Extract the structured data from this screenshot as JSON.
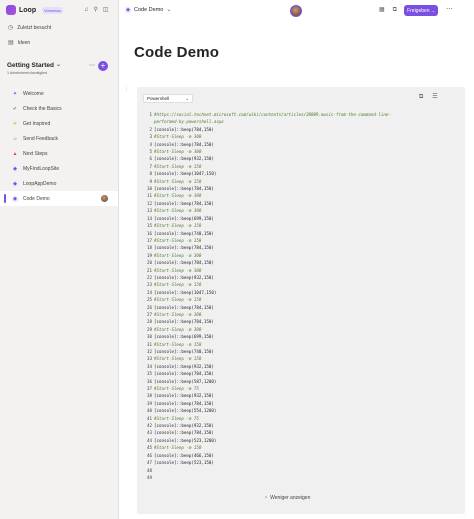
{
  "app": {
    "name": "Loop",
    "badge": "Vorschau"
  },
  "sidebar": {
    "nav": [
      {
        "label": "Zuletzt besucht",
        "icon": "clock-icon"
      },
      {
        "label": "Ideen",
        "icon": "ideas-icon"
      }
    ],
    "workspace": {
      "title": "Getting Started",
      "subtitle": "1 Arbeitsbereichsmitglied",
      "add_label": "+"
    },
    "pages": [
      {
        "label": "Welcome",
        "icon": "✦",
        "color": "#7b4fe0"
      },
      {
        "label": "Check the Basics",
        "icon": "✔",
        "color": "#3a9a3a"
      },
      {
        "label": "Get Inspired",
        "icon": "☀",
        "color": "#e0a020"
      },
      {
        "label": "Send Feedback",
        "icon": "☺",
        "color": "#e07020"
      },
      {
        "label": "Next Steps",
        "icon": "▲",
        "color": "#d84a4a"
      },
      {
        "label": "MyFirstLoopSite",
        "icon": "◆",
        "color": "#7b4fe0"
      },
      {
        "label": "LoopAppDemo",
        "icon": "◆",
        "color": "#7b4fe0"
      },
      {
        "label": "Code Demo",
        "icon": "◆",
        "color": "#7b4fe0",
        "active": true
      }
    ]
  },
  "topbar": {
    "breadcrumb": "Code Demo",
    "share_label": "Freigeben"
  },
  "page": {
    "title": "Code Demo"
  },
  "code": {
    "language": "Powershell",
    "footer": "Weniger anzeigen",
    "lines": [
      {
        "n": "1",
        "t": "#https://social.technet.microsoft.com/wiki/contents/articles/20009.music-from-the-command-line-",
        "t2": "performed-by-powershell.aspx",
        "c": true
      },
      {
        "n": "2",
        "t": "[console]::beep(784,150)"
      },
      {
        "n": "3",
        "t": "#Start-Sleep -m 300",
        "c": true
      },
      {
        "n": "4",
        "t": "[console]::beep(784,150)"
      },
      {
        "n": "5",
        "t": "#Start-Sleep -m 300",
        "c": true
      },
      {
        "n": "6",
        "t": "[console]::beep(932,150)"
      },
      {
        "n": "7",
        "t": "#Start-Sleep -m 150",
        "c": true
      },
      {
        "n": "8",
        "t": "[console]::beep(1047,150)"
      },
      {
        "n": "9",
        "t": "#Start-Sleep -m 150",
        "c": true
      },
      {
        "n": "10",
        "t": "[console]::beep(784,150)"
      },
      {
        "n": "11",
        "t": "#Start-Sleep -m 300",
        "c": true
      },
      {
        "n": "12",
        "t": "[console]::beep(784,150)"
      },
      {
        "n": "13",
        "t": "#Start-Sleep -m 300",
        "c": true
      },
      {
        "n": "14",
        "t": "[console]::beep(699,150)"
      },
      {
        "n": "15",
        "t": "#Start-Sleep -m 150",
        "c": true
      },
      {
        "n": "16",
        "t": "[console]::beep(740,150)"
      },
      {
        "n": "17",
        "t": "#Start-Sleep -m 150",
        "c": true
      },
      {
        "n": "18",
        "t": "[console]::beep(784,150)"
      },
      {
        "n": "19",
        "t": "#Start-Sleep -m 300",
        "c": true
      },
      {
        "n": "20",
        "t": "[console]::beep(784,150)"
      },
      {
        "n": "21",
        "t": "#Start-Sleep -m 300",
        "c": true
      },
      {
        "n": "22",
        "t": "[console]::beep(932,150)"
      },
      {
        "n": "23",
        "t": "#Start-Sleep -m 150",
        "c": true
      },
      {
        "n": "24",
        "t": "[console]::beep(1047,150)"
      },
      {
        "n": "25",
        "t": "#Start-Sleep -m 150",
        "c": true
      },
      {
        "n": "26",
        "t": "[console]::beep(784,150)"
      },
      {
        "n": "27",
        "t": "#Start-Sleep -m 300",
        "c": true
      },
      {
        "n": "28",
        "t": "[console]::beep(784,150)"
      },
      {
        "n": "29",
        "t": "#Start-Sleep -m 300",
        "c": true
      },
      {
        "n": "30",
        "t": "[console]::beep(699,150)"
      },
      {
        "n": "31",
        "t": "#Start-Sleep -m 150",
        "c": true
      },
      {
        "n": "32",
        "t": "[console]::beep(740,150)"
      },
      {
        "n": "33",
        "t": "#Start-Sleep -m 150",
        "c": true
      },
      {
        "n": "34",
        "t": "[console]::beep(932,150)"
      },
      {
        "n": "35",
        "t": "[console]::beep(784,150)"
      },
      {
        "n": "36",
        "t": "[console]::beep(587,1200)"
      },
      {
        "n": "37",
        "t": "#Start-Sleep -m 75",
        "c": true
      },
      {
        "n": "38",
        "t": "[console]::beep(932,150)"
      },
      {
        "n": "39",
        "t": "[console]::beep(784,150)"
      },
      {
        "n": "40",
        "t": "[console]::beep(554,1200)"
      },
      {
        "n": "41",
        "t": "#Start-Sleep -m 75",
        "c": true
      },
      {
        "n": "42",
        "t": "[console]::beep(932,150)"
      },
      {
        "n": "43",
        "t": "[console]::beep(784,150)"
      },
      {
        "n": "44",
        "t": "[console]::beep(523,1200)"
      },
      {
        "n": "45",
        "t": "#Start-Sleep -m 150",
        "c": true
      },
      {
        "n": "46",
        "t": "[console]::beep(466,150)"
      },
      {
        "n": "47",
        "t": "[console]::beep(523,150)"
      },
      {
        "n": "48",
        "t": ""
      },
      {
        "n": "49",
        "t": ""
      }
    ]
  },
  "colors": {
    "accent": "#7b4fe0",
    "comment": "#4f7a28",
    "sidebar_bg": "#f3f2f1",
    "code_bg": "#f0f0f0"
  }
}
